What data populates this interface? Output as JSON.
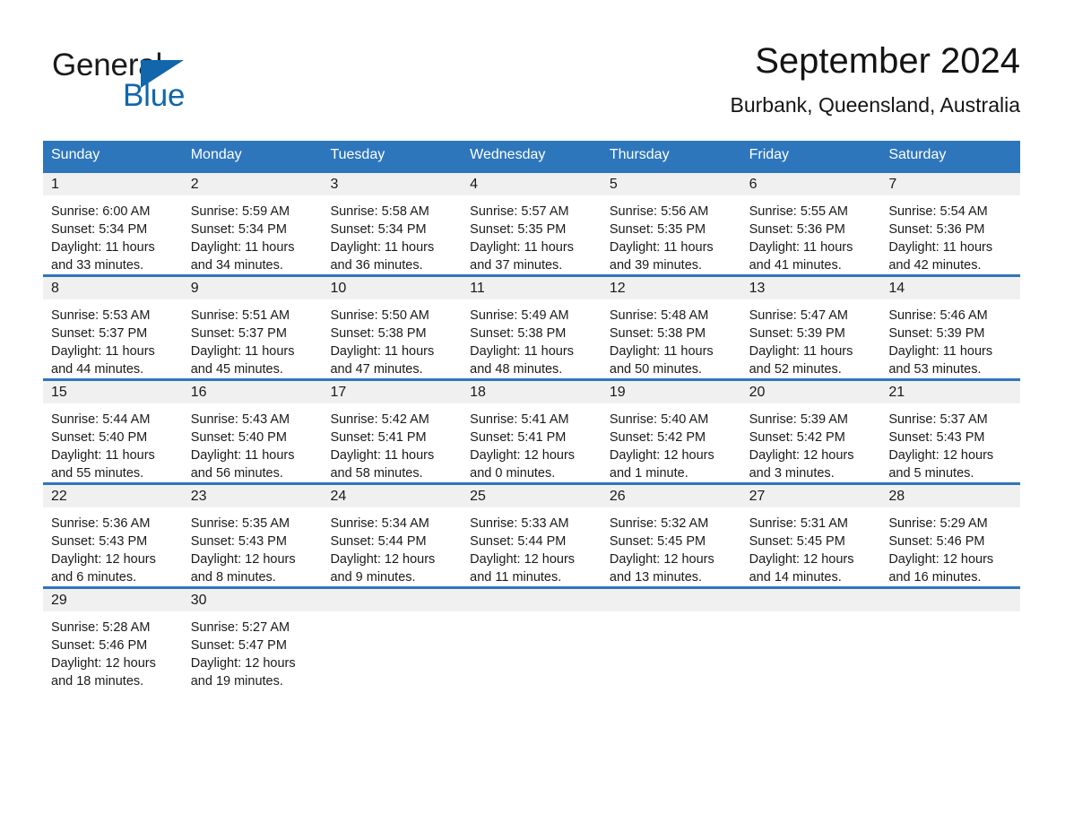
{
  "brand": {
    "name_part1": "General",
    "name_part2": "Blue",
    "accent_color": "#1266ab"
  },
  "header": {
    "title": "September 2024",
    "subtitle": "Burbank, Queensland, Australia"
  },
  "theme": {
    "header_blue": "#2e76bc",
    "day_band_gray": "#f0f0f0",
    "text_color": "#1a1a1a"
  },
  "weekdays": [
    "Sunday",
    "Monday",
    "Tuesday",
    "Wednesday",
    "Thursday",
    "Friday",
    "Saturday"
  ],
  "weeks": [
    {
      "days": [
        {
          "date": "1",
          "sunrise": "Sunrise: 6:00 AM",
          "sunset": "Sunset: 5:34 PM",
          "daylight_line1": "Daylight: 11 hours",
          "daylight_line2": "and 33 minutes."
        },
        {
          "date": "2",
          "sunrise": "Sunrise: 5:59 AM",
          "sunset": "Sunset: 5:34 PM",
          "daylight_line1": "Daylight: 11 hours",
          "daylight_line2": "and 34 minutes."
        },
        {
          "date": "3",
          "sunrise": "Sunrise: 5:58 AM",
          "sunset": "Sunset: 5:34 PM",
          "daylight_line1": "Daylight: 11 hours",
          "daylight_line2": "and 36 minutes."
        },
        {
          "date": "4",
          "sunrise": "Sunrise: 5:57 AM",
          "sunset": "Sunset: 5:35 PM",
          "daylight_line1": "Daylight: 11 hours",
          "daylight_line2": "and 37 minutes."
        },
        {
          "date": "5",
          "sunrise": "Sunrise: 5:56 AM",
          "sunset": "Sunset: 5:35 PM",
          "daylight_line1": "Daylight: 11 hours",
          "daylight_line2": "and 39 minutes."
        },
        {
          "date": "6",
          "sunrise": "Sunrise: 5:55 AM",
          "sunset": "Sunset: 5:36 PM",
          "daylight_line1": "Daylight: 11 hours",
          "daylight_line2": "and 41 minutes."
        },
        {
          "date": "7",
          "sunrise": "Sunrise: 5:54 AM",
          "sunset": "Sunset: 5:36 PM",
          "daylight_line1": "Daylight: 11 hours",
          "daylight_line2": "and 42 minutes."
        }
      ]
    },
    {
      "days": [
        {
          "date": "8",
          "sunrise": "Sunrise: 5:53 AM",
          "sunset": "Sunset: 5:37 PM",
          "daylight_line1": "Daylight: 11 hours",
          "daylight_line2": "and 44 minutes."
        },
        {
          "date": "9",
          "sunrise": "Sunrise: 5:51 AM",
          "sunset": "Sunset: 5:37 PM",
          "daylight_line1": "Daylight: 11 hours",
          "daylight_line2": "and 45 minutes."
        },
        {
          "date": "10",
          "sunrise": "Sunrise: 5:50 AM",
          "sunset": "Sunset: 5:38 PM",
          "daylight_line1": "Daylight: 11 hours",
          "daylight_line2": "and 47 minutes."
        },
        {
          "date": "11",
          "sunrise": "Sunrise: 5:49 AM",
          "sunset": "Sunset: 5:38 PM",
          "daylight_line1": "Daylight: 11 hours",
          "daylight_line2": "and 48 minutes."
        },
        {
          "date": "12",
          "sunrise": "Sunrise: 5:48 AM",
          "sunset": "Sunset: 5:38 PM",
          "daylight_line1": "Daylight: 11 hours",
          "daylight_line2": "and 50 minutes."
        },
        {
          "date": "13",
          "sunrise": "Sunrise: 5:47 AM",
          "sunset": "Sunset: 5:39 PM",
          "daylight_line1": "Daylight: 11 hours",
          "daylight_line2": "and 52 minutes."
        },
        {
          "date": "14",
          "sunrise": "Sunrise: 5:46 AM",
          "sunset": "Sunset: 5:39 PM",
          "daylight_line1": "Daylight: 11 hours",
          "daylight_line2": "and 53 minutes."
        }
      ]
    },
    {
      "days": [
        {
          "date": "15",
          "sunrise": "Sunrise: 5:44 AM",
          "sunset": "Sunset: 5:40 PM",
          "daylight_line1": "Daylight: 11 hours",
          "daylight_line2": "and 55 minutes."
        },
        {
          "date": "16",
          "sunrise": "Sunrise: 5:43 AM",
          "sunset": "Sunset: 5:40 PM",
          "daylight_line1": "Daylight: 11 hours",
          "daylight_line2": "and 56 minutes."
        },
        {
          "date": "17",
          "sunrise": "Sunrise: 5:42 AM",
          "sunset": "Sunset: 5:41 PM",
          "daylight_line1": "Daylight: 11 hours",
          "daylight_line2": "and 58 minutes."
        },
        {
          "date": "18",
          "sunrise": "Sunrise: 5:41 AM",
          "sunset": "Sunset: 5:41 PM",
          "daylight_line1": "Daylight: 12 hours",
          "daylight_line2": "and 0 minutes."
        },
        {
          "date": "19",
          "sunrise": "Sunrise: 5:40 AM",
          "sunset": "Sunset: 5:42 PM",
          "daylight_line1": "Daylight: 12 hours",
          "daylight_line2": "and 1 minute."
        },
        {
          "date": "20",
          "sunrise": "Sunrise: 5:39 AM",
          "sunset": "Sunset: 5:42 PM",
          "daylight_line1": "Daylight: 12 hours",
          "daylight_line2": "and 3 minutes."
        },
        {
          "date": "21",
          "sunrise": "Sunrise: 5:37 AM",
          "sunset": "Sunset: 5:43 PM",
          "daylight_line1": "Daylight: 12 hours",
          "daylight_line2": "and 5 minutes."
        }
      ]
    },
    {
      "days": [
        {
          "date": "22",
          "sunrise": "Sunrise: 5:36 AM",
          "sunset": "Sunset: 5:43 PM",
          "daylight_line1": "Daylight: 12 hours",
          "daylight_line2": "and 6 minutes."
        },
        {
          "date": "23",
          "sunrise": "Sunrise: 5:35 AM",
          "sunset": "Sunset: 5:43 PM",
          "daylight_line1": "Daylight: 12 hours",
          "daylight_line2": "and 8 minutes."
        },
        {
          "date": "24",
          "sunrise": "Sunrise: 5:34 AM",
          "sunset": "Sunset: 5:44 PM",
          "daylight_line1": "Daylight: 12 hours",
          "daylight_line2": "and 9 minutes."
        },
        {
          "date": "25",
          "sunrise": "Sunrise: 5:33 AM",
          "sunset": "Sunset: 5:44 PM",
          "daylight_line1": "Daylight: 12 hours",
          "daylight_line2": "and 11 minutes."
        },
        {
          "date": "26",
          "sunrise": "Sunrise: 5:32 AM",
          "sunset": "Sunset: 5:45 PM",
          "daylight_line1": "Daylight: 12 hours",
          "daylight_line2": "and 13 minutes."
        },
        {
          "date": "27",
          "sunrise": "Sunrise: 5:31 AM",
          "sunset": "Sunset: 5:45 PM",
          "daylight_line1": "Daylight: 12 hours",
          "daylight_line2": "and 14 minutes."
        },
        {
          "date": "28",
          "sunrise": "Sunrise: 5:29 AM",
          "sunset": "Sunset: 5:46 PM",
          "daylight_line1": "Daylight: 12 hours",
          "daylight_line2": "and 16 minutes."
        }
      ]
    },
    {
      "days": [
        {
          "date": "29",
          "sunrise": "Sunrise: 5:28 AM",
          "sunset": "Sunset: 5:46 PM",
          "daylight_line1": "Daylight: 12 hours",
          "daylight_line2": "and 18 minutes."
        },
        {
          "date": "30",
          "sunrise": "Sunrise: 5:27 AM",
          "sunset": "Sunset: 5:47 PM",
          "daylight_line1": "Daylight: 12 hours",
          "daylight_line2": "and 19 minutes."
        },
        {
          "date": "",
          "sunrise": "",
          "sunset": "",
          "daylight_line1": "",
          "daylight_line2": ""
        },
        {
          "date": "",
          "sunrise": "",
          "sunset": "",
          "daylight_line1": "",
          "daylight_line2": ""
        },
        {
          "date": "",
          "sunrise": "",
          "sunset": "",
          "daylight_line1": "",
          "daylight_line2": ""
        },
        {
          "date": "",
          "sunrise": "",
          "sunset": "",
          "daylight_line1": "",
          "daylight_line2": ""
        },
        {
          "date": "",
          "sunrise": "",
          "sunset": "",
          "daylight_line1": "",
          "daylight_line2": ""
        }
      ]
    }
  ]
}
